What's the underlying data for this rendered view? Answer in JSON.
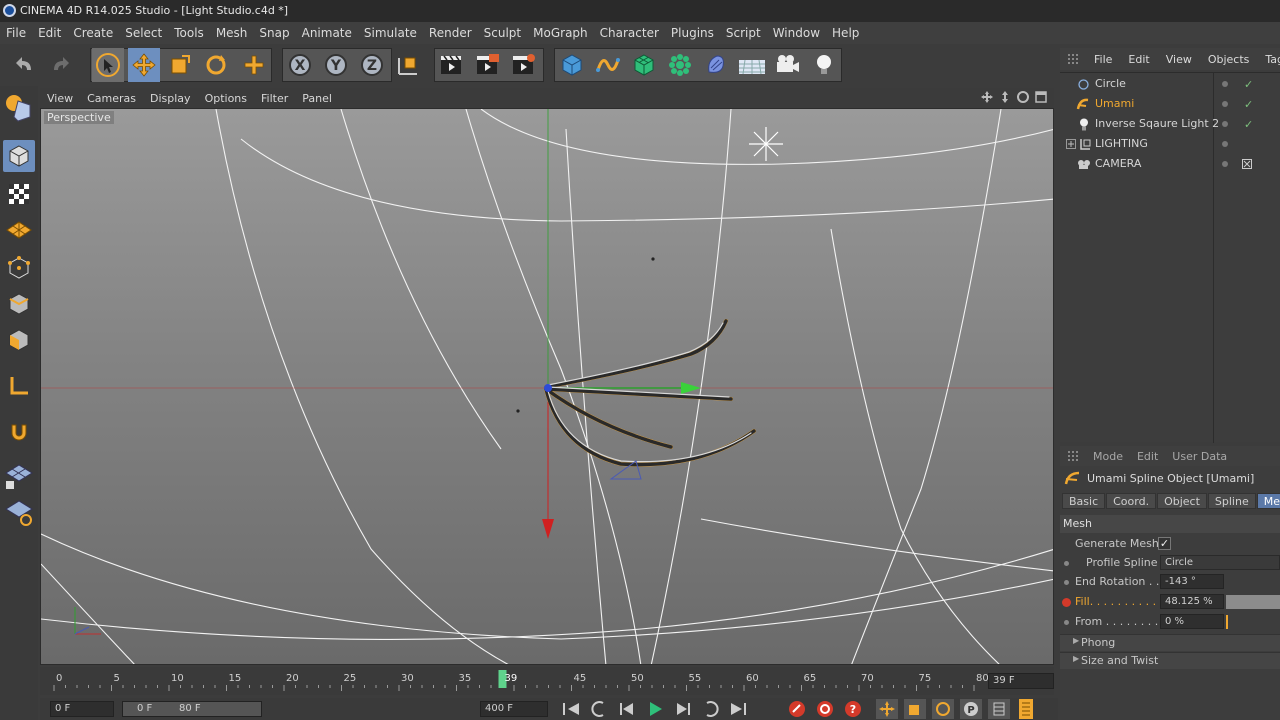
{
  "window": {
    "title": "CINEMA 4D R14.025 Studio - [Light Studio.c4d *]"
  },
  "menubar": [
    "File",
    "Edit",
    "Create",
    "Select",
    "Tools",
    "Mesh",
    "Snap",
    "Animate",
    "Simulate",
    "Render",
    "Sculpt",
    "MoGraph",
    "Character",
    "Plugins",
    "Script",
    "Window",
    "Help"
  ],
  "viewport": {
    "menu": [
      "View",
      "Cameras",
      "Display",
      "Options",
      "Filter",
      "Panel"
    ],
    "label": "Perspective"
  },
  "object_manager": {
    "menu": [
      "File",
      "Edit",
      "View",
      "Objects",
      "Tags"
    ],
    "objects": [
      {
        "name": "Circle",
        "icon": "circle-spline-icon",
        "color": "#d6d6d6"
      },
      {
        "name": "Umami",
        "icon": "spline-object-icon",
        "color": "#f0a830"
      },
      {
        "name": "Inverse Sqaure Light 2",
        "icon": "light-icon",
        "color": "#d6d6d6"
      },
      {
        "name": "LIGHTING",
        "icon": "null-object-icon",
        "color": "#d6d6d6"
      },
      {
        "name": "CAMERA",
        "icon": "camera-icon",
        "color": "#d6d6d6"
      }
    ]
  },
  "attribute_manager": {
    "menu": [
      "Mode",
      "Edit",
      "User Data"
    ],
    "object_title": "Umami Spline Object [Umami]",
    "tabs": [
      "Basic",
      "Coord.",
      "Object",
      "Spline",
      "Mesh"
    ],
    "active_tab": "Mesh",
    "section": "Mesh",
    "fields": [
      {
        "label": "Generate Mesh",
        "value": "✓"
      },
      {
        "label": "Profile Spline",
        "value": "Circle"
      },
      {
        "label": "End Rotation . .",
        "value": "-143 °"
      },
      {
        "label": "Fill. . . . . . . . . .",
        "value": "48.125 %"
      },
      {
        "label": "From . . . . . . . .",
        "value": "0 %"
      }
    ],
    "groups": [
      "Phong",
      "Size and Twist"
    ]
  },
  "timeline": {
    "ticks": [
      "0",
      "5",
      "10",
      "15",
      "20",
      "25",
      "30",
      "35",
      "39",
      "45",
      "50",
      "55",
      "60",
      "65",
      "70",
      "75",
      "80"
    ],
    "current_frame_label": "39",
    "current_frame_field": "39 F",
    "start_field": "0 F",
    "range_start": "0 F",
    "range_end": "80 F",
    "max_field": "400 F",
    "accent": "#5fd38c"
  },
  "colors": {
    "accent": "#f0a830",
    "selected_tab": "#5b79a8"
  }
}
